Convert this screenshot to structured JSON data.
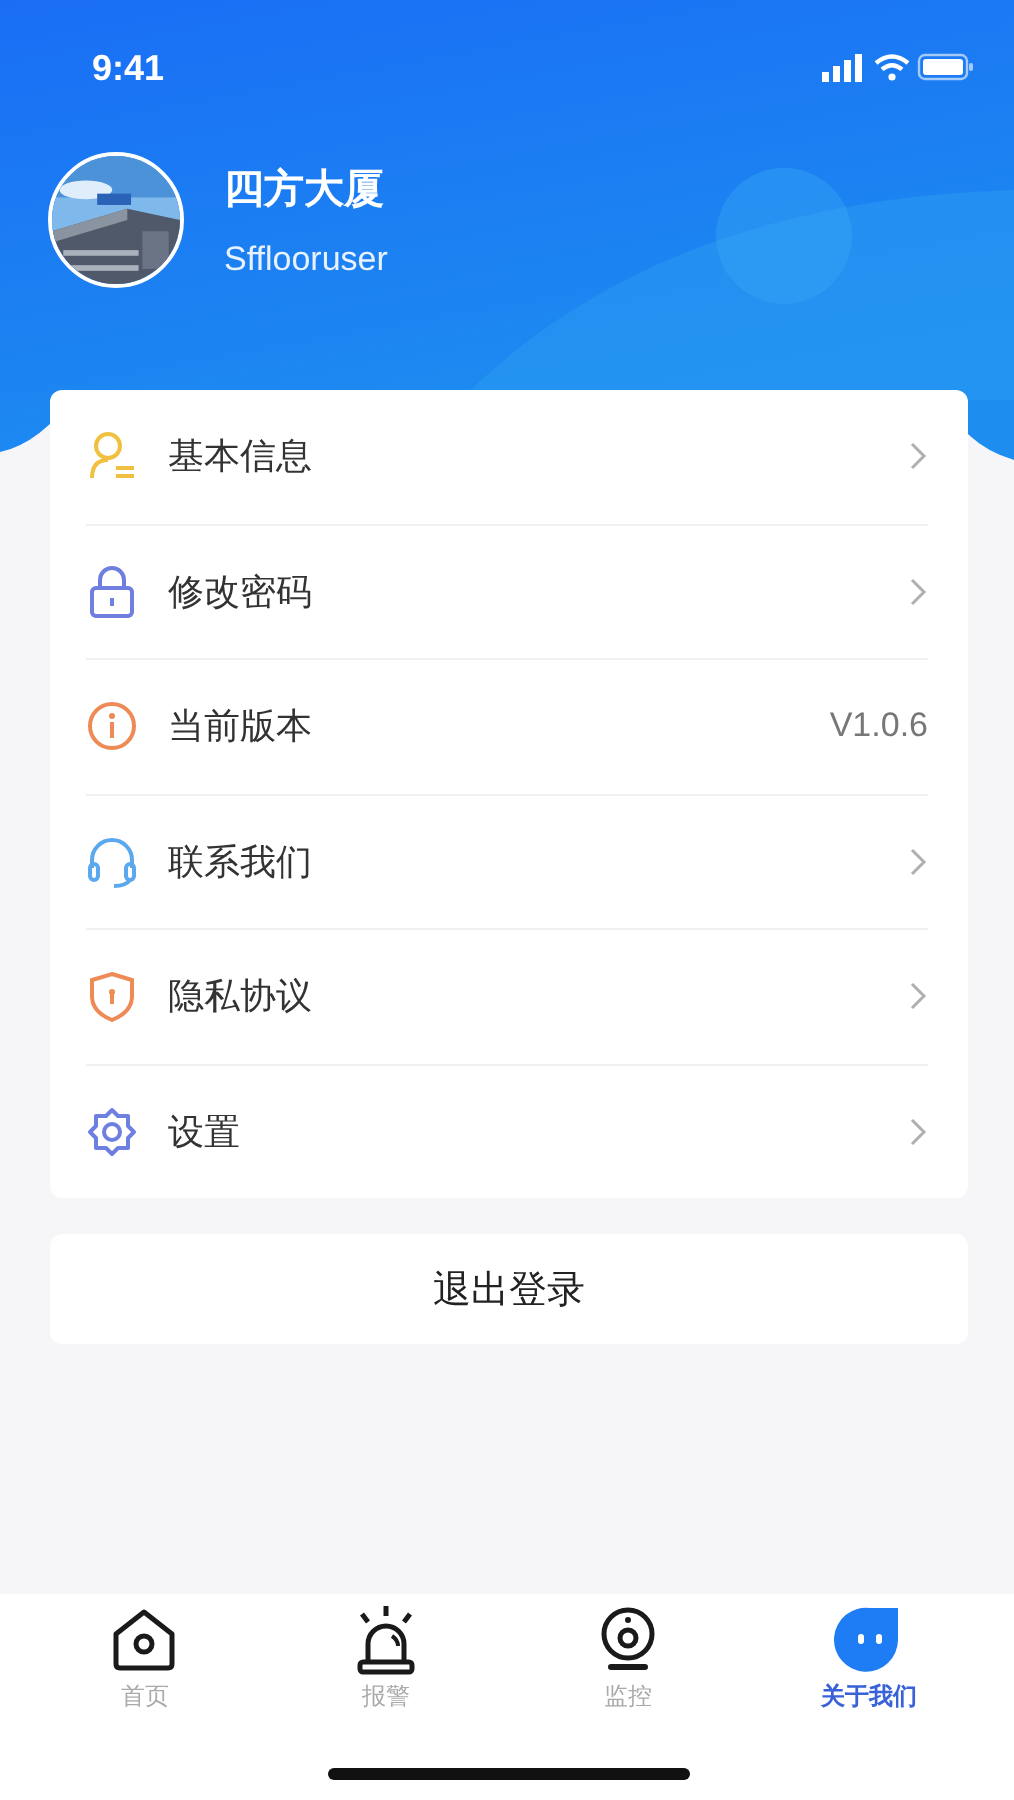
{
  "status_bar": {
    "time": "9:41"
  },
  "profile": {
    "name": "四方大厦",
    "username": "Sfflooruser"
  },
  "menu": [
    {
      "label": "基本信息",
      "kind": "link",
      "color": "#f0c040"
    },
    {
      "label": "修改密码",
      "kind": "link",
      "color": "#6f7fe0"
    },
    {
      "label": "当前版本",
      "kind": "value",
      "value": "V1.0.6",
      "color": "#ee8a55"
    },
    {
      "label": "联系我们",
      "kind": "link",
      "color": "#5aa8ee"
    },
    {
      "label": "隐私协议",
      "kind": "link",
      "color": "#ee8a55"
    },
    {
      "label": "设置",
      "kind": "link",
      "color": "#6f7fe0"
    }
  ],
  "logout_button": "退出登录",
  "tabs": [
    {
      "label": "首页",
      "selected": false
    },
    {
      "label": "报警",
      "selected": false
    },
    {
      "label": "监控",
      "selected": false
    },
    {
      "label": "关于我们",
      "selected": true
    }
  ]
}
